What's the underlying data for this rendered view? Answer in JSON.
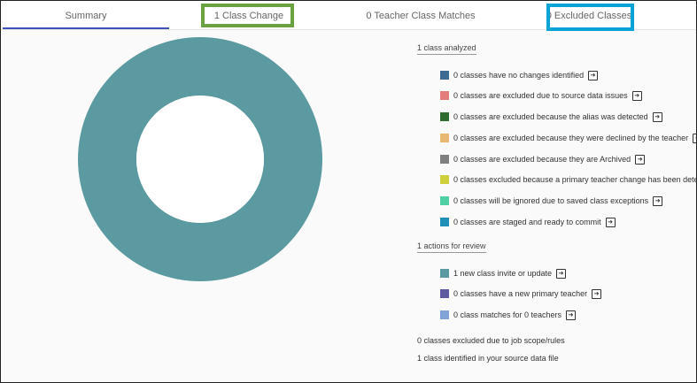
{
  "tabs": [
    {
      "label": "Summary",
      "active": true
    },
    {
      "label": "1 Class Change"
    },
    {
      "label": "0 Teacher Class Matches"
    },
    {
      "label": "0 Excluded Classes"
    }
  ],
  "chart_data": {
    "type": "pie",
    "variant": "donut",
    "slices": [
      {
        "value": 1,
        "color": "#5b9aa0"
      }
    ]
  },
  "analyzed": {
    "title": "1 class analyzed",
    "items": [
      {
        "label": "0 classes have no changes identified",
        "color": "#3d6a93"
      },
      {
        "label": "0 classes are excluded due to source data issues",
        "color": "#e57c7c"
      },
      {
        "label": "0 classes are excluded because the alias was detected",
        "color": "#2d6b2f"
      },
      {
        "label": "0 classes are excluded because they were declined by the teacher",
        "color": "#e8b774"
      },
      {
        "label": "0 classes are excluded because they are Archived",
        "color": "#808080"
      },
      {
        "label": "0 classes excluded because a primary teacher change has been detec",
        "color": "#cfcf3c"
      },
      {
        "label": "0 classes will be ignored due to saved class exceptions",
        "color": "#4fcfa4"
      },
      {
        "label": "0 classes are staged and ready to commit",
        "color": "#1f8fb8"
      }
    ]
  },
  "review": {
    "title": "1 actions for review",
    "items": [
      {
        "label": "1 new class invite or update",
        "color": "#5b9aa0"
      },
      {
        "label": "0 classes have a new primary teacher",
        "color": "#5e5ba0"
      },
      {
        "label": "0 class matches for 0 teachers",
        "color": "#7fa3d6"
      }
    ]
  },
  "footer": {
    "excluded_scope": "0 classes excluded due to job scope/rules",
    "identified": "1 class identified in your source data file"
  },
  "icons": {
    "goto": "open-in-icon"
  }
}
